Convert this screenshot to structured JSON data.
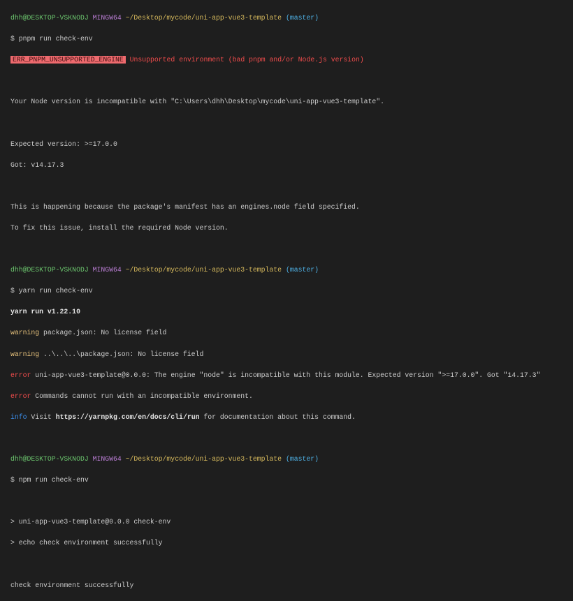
{
  "prompt": {
    "user": "dhh@DESKTOP-VSKNODJ",
    "shell": "MINGW64",
    "path": "~/Desktop/mycode/uni-app-vue3-template",
    "branch": "(master)"
  },
  "block1": {
    "command": "$ pnpm run check-env",
    "err_code": "ERR_PNPM_UNSUPPORTED_ENGINE",
    "err_msg": "Unsupported environment (bad pnpm and/or Node.js version)",
    "incompatible": "Your Node version is incompatible with \"C:\\Users\\dhh\\Desktop\\mycode\\uni-app-vue3-template\".",
    "expected": "Expected version: >=17.0.0",
    "got": "Got: v14.17.3",
    "reason": "This is happening because the package's manifest has an engines.node field specified.",
    "fix": "To fix this issue, install the required Node version."
  },
  "block2": {
    "command": "$ yarn run check-env",
    "version": "yarn run v1.22.10",
    "lines": [
      {
        "level": "warning",
        "text": " package.json: No license field"
      },
      {
        "level": "warning",
        "text": " ..\\..\\..\\package.json: No license field"
      },
      {
        "level": "error",
        "text": " uni-app-vue3-template@0.0.0: The engine \"node\" is incompatible with this module. Expected version \">=17.0.0\". Got \"14.17.3\""
      },
      {
        "level": "error",
        "text": " Commands cannot run with an incompatible environment."
      }
    ],
    "info_level": "info",
    "info_pre": " Visit ",
    "info_url": "https://yarnpkg.com/en/docs/cli/run",
    "info_post": " for documentation about this command."
  },
  "block3": {
    "command": "$ npm run check-env",
    "line1": "> uni-app-vue3-template@0.0.0 check-env",
    "line2": "> echo check environment successfully",
    "output": "check environment successfully"
  }
}
